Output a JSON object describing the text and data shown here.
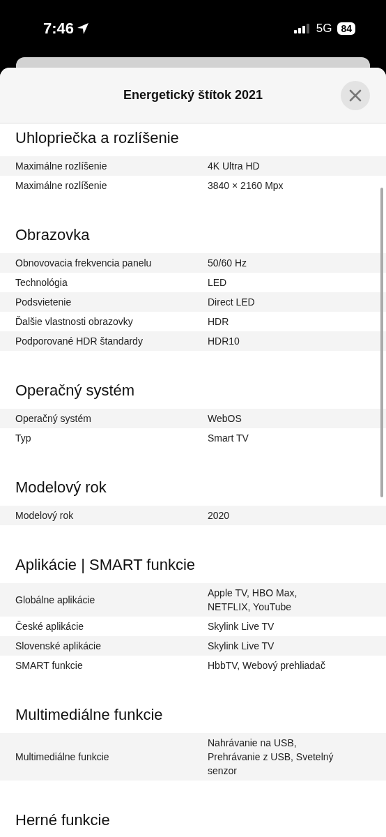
{
  "status_bar": {
    "time": "7:46",
    "network": "5G",
    "battery": "84"
  },
  "sheet": {
    "title": "Energetický štítok 2021"
  },
  "sections": [
    {
      "title": "Uhlopriečka a rozlíšenie",
      "rows": [
        {
          "label": "Maximálne rozlíšenie",
          "value": "4K Ultra HD"
        },
        {
          "label": "Maximálne rozlíšenie",
          "value": "3840 × 2160 Mpx"
        }
      ]
    },
    {
      "title": "Obrazovka",
      "rows": [
        {
          "label": "Obnovovacia frekvencia panelu",
          "value": "50/60 Hz"
        },
        {
          "label": "Technológia",
          "value": "LED"
        },
        {
          "label": "Podsvietenie",
          "value": "Direct LED"
        },
        {
          "label": "Ďalšie vlastnosti obrazovky",
          "value": "HDR"
        },
        {
          "label": "Podporované HDR štandardy",
          "value": "HDR10"
        }
      ]
    },
    {
      "title": "Operačný systém",
      "rows": [
        {
          "label": "Operačný systém",
          "value": "WebOS"
        },
        {
          "label": "Typ",
          "value": "Smart TV"
        }
      ]
    },
    {
      "title": "Modelový rok",
      "rows": [
        {
          "label": "Modelový rok",
          "value": "2020"
        }
      ]
    },
    {
      "title": "Aplikácie | SMART funkcie",
      "rows": [
        {
          "label": "Globálne aplikácie",
          "value": "Apple TV, HBO Max,\nNETFLIX, YouTube"
        },
        {
          "label": "České aplikácie",
          "value": "Skylink Live TV"
        },
        {
          "label": "Slovenské aplikácie",
          "value": "Skylink Live TV"
        },
        {
          "label": "SMART funkcie",
          "value": "HbbTV, Webový prehliadač"
        }
      ]
    },
    {
      "title": "Multimediálne funkcie",
      "rows": [
        {
          "label": "Multimediálne funkcie",
          "value": "Nahrávanie na USB,\nPrehrávanie z USB, Svetelný\nsenzor"
        }
      ]
    },
    {
      "title": "Herné funkcie"
    }
  ]
}
